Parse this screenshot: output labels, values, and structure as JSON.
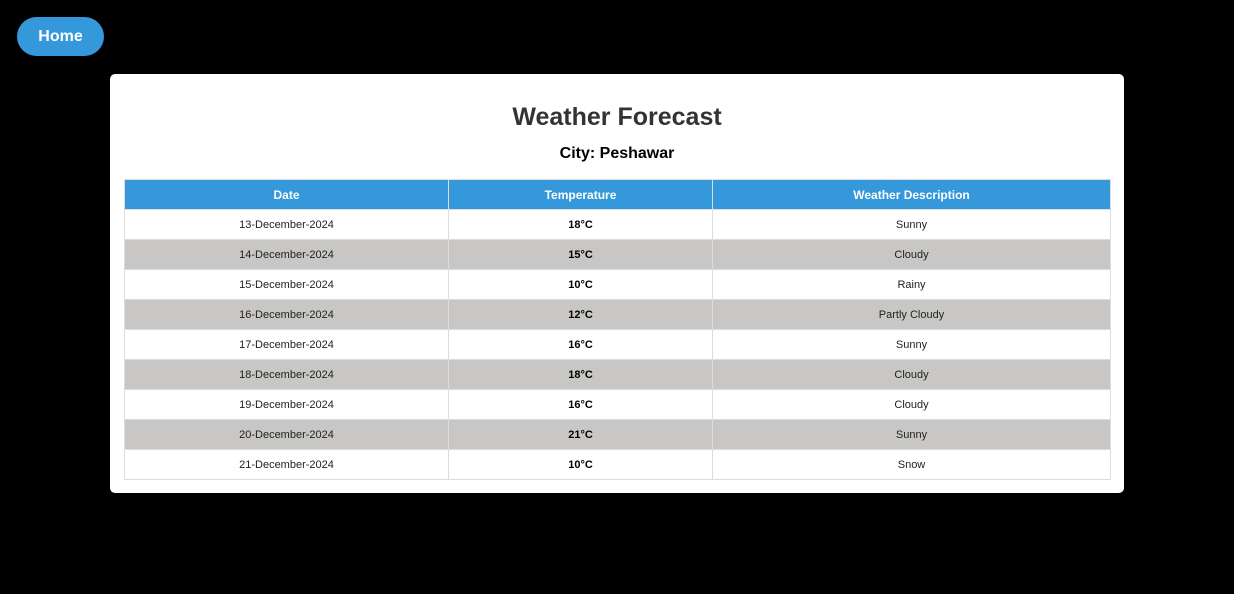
{
  "nav": {
    "home_label": "Home"
  },
  "page": {
    "title": "Weather Forecast",
    "city_label": "City: Peshawar"
  },
  "table": {
    "columns": [
      "Date",
      "Temperature",
      "Weather Description"
    ],
    "rows": [
      {
        "date": "13-December-2024",
        "temperature": "18°C",
        "description": "Sunny"
      },
      {
        "date": "14-December-2024",
        "temperature": "15°C",
        "description": "Cloudy"
      },
      {
        "date": "15-December-2024",
        "temperature": "10°C",
        "description": "Rainy"
      },
      {
        "date": "16-December-2024",
        "temperature": "12°C",
        "description": "Partly Cloudy"
      },
      {
        "date": "17-December-2024",
        "temperature": "16°C",
        "description": "Sunny"
      },
      {
        "date": "18-December-2024",
        "temperature": "18°C",
        "description": "Cloudy"
      },
      {
        "date": "19-December-2024",
        "temperature": "16°C",
        "description": "Cloudy"
      },
      {
        "date": "20-December-2024",
        "temperature": "21°C",
        "description": "Sunny"
      },
      {
        "date": "21-December-2024",
        "temperature": "10°C",
        "description": "Snow"
      }
    ]
  },
  "colors": {
    "accent": "#3498db",
    "background": "#000000",
    "card": "#ffffff",
    "striped_row": "#c8c7c5"
  }
}
